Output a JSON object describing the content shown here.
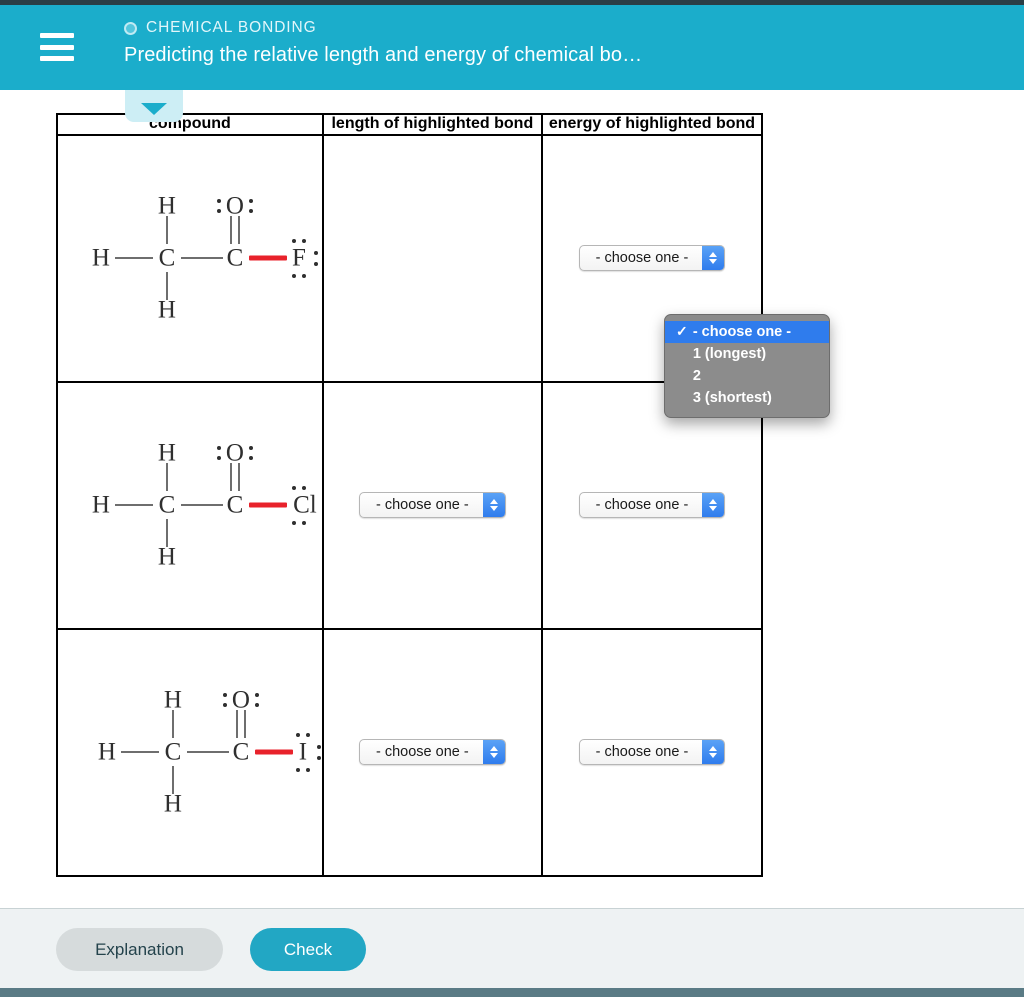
{
  "header": {
    "menu_icon": "hamburger-menu-icon",
    "kicker_icon": "circle-icon",
    "kicker": "CHEMICAL BONDING",
    "title": "Predicting the relative length and energy of chemical bo…"
  },
  "collapse_tab": {
    "icon": "caret-down-icon"
  },
  "table": {
    "columns": [
      {
        "label": "compound"
      },
      {
        "label": "length of highlighted bond"
      },
      {
        "label": "energy of highlighted bond"
      }
    ],
    "rows": [
      {
        "compound_name": "acetyl-fluoride",
        "atoms": {
          "h_top": "H",
          "h_left": "H",
          "h_bottom": "H",
          "c_left": "C",
          "c_right": "C",
          "o": "O",
          "halogen": "F"
        },
        "length_select": {
          "value": "- choose one -",
          "open": true
        },
        "energy_select": {
          "value": "- choose one -",
          "open": false
        }
      },
      {
        "compound_name": "acetyl-chloride",
        "atoms": {
          "h_top": "H",
          "h_left": "H",
          "h_bottom": "H",
          "c_left": "C",
          "c_right": "C",
          "o": "O",
          "halogen": "Cl"
        },
        "length_select": {
          "value": "- choose one -",
          "open": false
        },
        "energy_select": {
          "value": "- choose one -",
          "open": false
        }
      },
      {
        "compound_name": "acetyl-iodide",
        "atoms": {
          "h_top": "H",
          "h_left": "H",
          "h_bottom": "H",
          "c_left": "C",
          "c_right": "C",
          "o": "O",
          "halogen": "I"
        },
        "length_select": {
          "value": "- choose one -",
          "open": false
        },
        "energy_select": {
          "value": "- choose one -",
          "open": false
        }
      }
    ]
  },
  "dropdown": {
    "check_glyph": "✓",
    "options": [
      {
        "label": "- choose one -",
        "selected": true
      },
      {
        "label": "1 (longest)",
        "selected": false
      },
      {
        "label": "2",
        "selected": false
      },
      {
        "label": "3 (shortest)",
        "selected": false
      }
    ]
  },
  "footer": {
    "explanation_label": "Explanation",
    "check_label": "Check"
  },
  "colors": {
    "header_teal": "#1BADCB",
    "check_button": "#22A7C4",
    "highlight_bond_red": "#e8222b",
    "dropdown_selected_blue": "#2f7ced",
    "tab_light_blue": "#cdeef5"
  }
}
